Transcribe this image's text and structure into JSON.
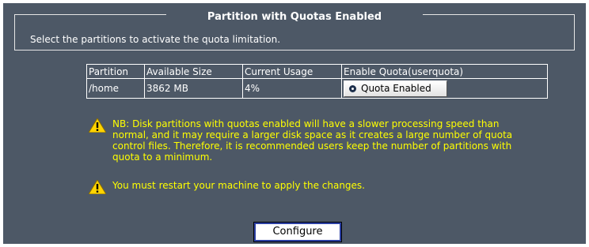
{
  "section": {
    "title": "Partition with Quotas Enabled",
    "description": "Select the partitions to activate the quota limitation."
  },
  "table": {
    "headers": [
      "Partition",
      "Available Size",
      "Current Usage",
      "Enable Quota(userquota)"
    ],
    "rows": [
      {
        "partition": "/home",
        "available_size": "3862 MB",
        "current_usage": "4%",
        "quota_button": "Quota Enabled"
      }
    ]
  },
  "notes": {
    "nb": "NB: Disk partitions with quotas enabled will have a slower processing speed than normal, and it may require a larger disk space as it creates a large number of quota control files. Therefore, it is recommended users keep the number of partitions with quota to a minimum.",
    "restart": "You must restart your machine to apply the changes."
  },
  "actions": {
    "configure_label": "Configure"
  },
  "icons": {
    "warning": "warning-icon",
    "radio": "radio-selected-icon"
  },
  "colors": {
    "panel_bg": "#4d5866",
    "warning_text": "#ffff00",
    "warning_icon": "#ffd400"
  }
}
